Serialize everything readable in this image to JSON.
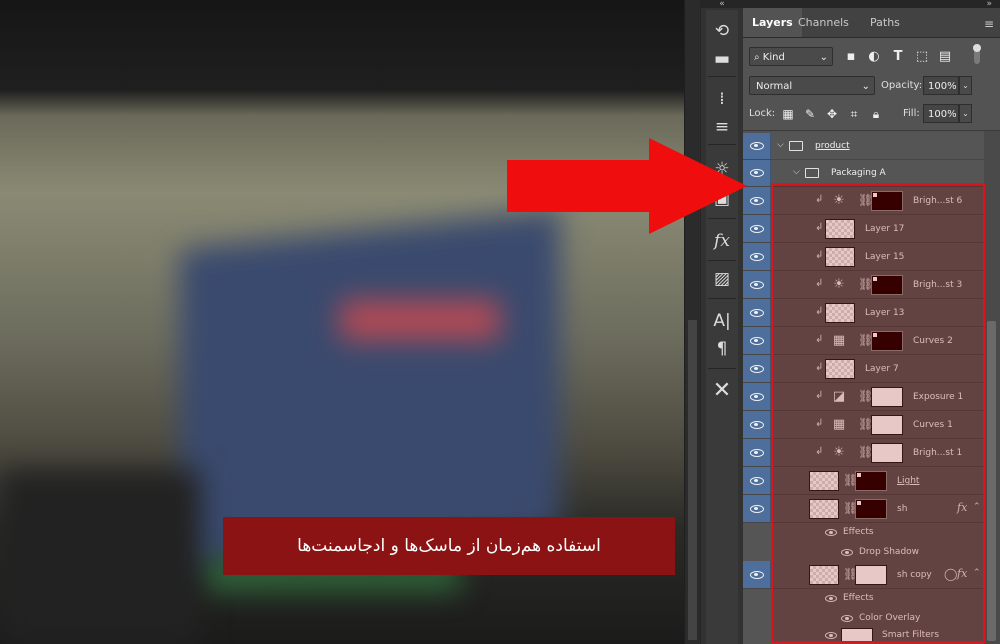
{
  "caption": "استفاده هم‌زمان از ماسک‌ها و ادجاسمنت‌ها",
  "colors": {
    "highlight": "#e0131d",
    "arrow": "#f00d0d",
    "caption_bg": "#8b1313",
    "panel_bg": "#535353",
    "eye_column": "#4e6f9c"
  },
  "panel": {
    "tabs": [
      "Layers",
      "Channels",
      "Paths"
    ],
    "active_tab": "Layers",
    "filter": {
      "kind_label": "Kind",
      "icons": [
        "image-filter-icon",
        "adjustment-filter-icon",
        "type-filter-icon",
        "shape-filter-icon",
        "smart-object-filter-icon"
      ]
    },
    "blend_mode": "Normal",
    "opacity_label": "Opacity:",
    "opacity": "100%",
    "lock_label": "Lock:",
    "fill_label": "Fill:",
    "fill": "100%"
  },
  "layers": {
    "product": {
      "name": "product"
    },
    "packaging_a": {
      "name": "Packaging A"
    },
    "brightness6": {
      "name": "Brigh...st 6"
    },
    "layer17": {
      "name": "Layer 17"
    },
    "layer15": {
      "name": "Layer 15"
    },
    "brightness3": {
      "name": "Brigh...st 3"
    },
    "layer13": {
      "name": "Layer 13"
    },
    "curves2": {
      "name": "Curves 2"
    },
    "layer7": {
      "name": "Layer 7"
    },
    "exposure1": {
      "name": "Exposure 1"
    },
    "curves1": {
      "name": "Curves 1"
    },
    "brightness1": {
      "name": "Brigh...st 1"
    },
    "light": {
      "name": "Light"
    },
    "sh": {
      "name": "sh",
      "effects_label": "Effects",
      "effect": "Drop Shadow"
    },
    "sh_copy": {
      "name": "sh copy",
      "effects_label": "Effects",
      "effect": "Color Overlay",
      "smart_filters": "Smart Filters"
    }
  },
  "toolbar_icons": [
    "history-icon",
    "comment-icon",
    "brush-settings-icon",
    "adjustments-sliders-icon",
    "libraries-icon",
    "layer-comps-icon",
    "styles-fx-icon",
    "image-icon",
    "character-icon",
    "paragraph-icon",
    "tools-icon"
  ]
}
